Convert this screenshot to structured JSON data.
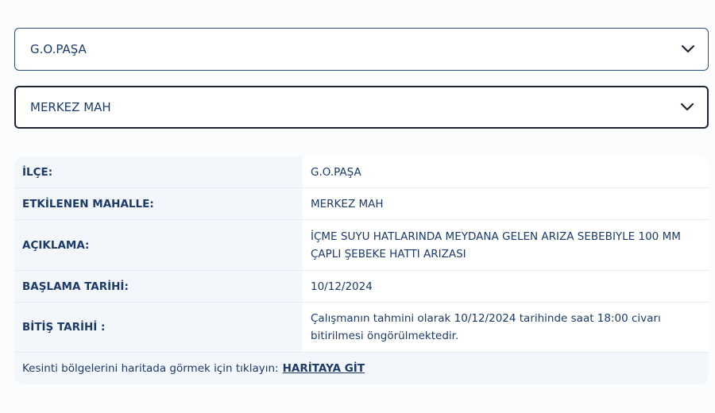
{
  "district_select": {
    "selected": "G.O.PAŞA",
    "icon": "chevron-down-icon"
  },
  "neighborhood_select": {
    "selected": "MERKEZ MAH",
    "icon": "chevron-down-icon"
  },
  "outage": {
    "rows": [
      {
        "label": "İLÇE:",
        "value": "G.O.PAŞA"
      },
      {
        "label": "ETKİLENEN MAHALLE:",
        "value": "MERKEZ MAH"
      },
      {
        "label": "AÇIKLAMA:",
        "value": "İÇME SUYU HATLARINDA MEYDANA GELEN ARIZA SEBEBIYLE 100 MM ÇAPLI ŞEBEKE HATTI ARIZASI"
      },
      {
        "label": "BAŞLAMA TARİHİ:",
        "value": "10/12/2024"
      },
      {
        "label": "BİTİŞ TARİHİ :",
        "value": "Çalışmanın tahmini olarak 10/12/2024 tarihinde saat 18:00 civarı bitirilmesi öngörülmektedir."
      }
    ],
    "map_prompt": "Kesinti bölgelerini haritada görmek için tıklayın:",
    "map_link": "HARİTAYA GİT"
  },
  "colors": {
    "text": "#1b3a6b",
    "panel_bg": "#f3f6fb",
    "border_default": "#2d4f86",
    "border_focused": "#1e2431"
  }
}
